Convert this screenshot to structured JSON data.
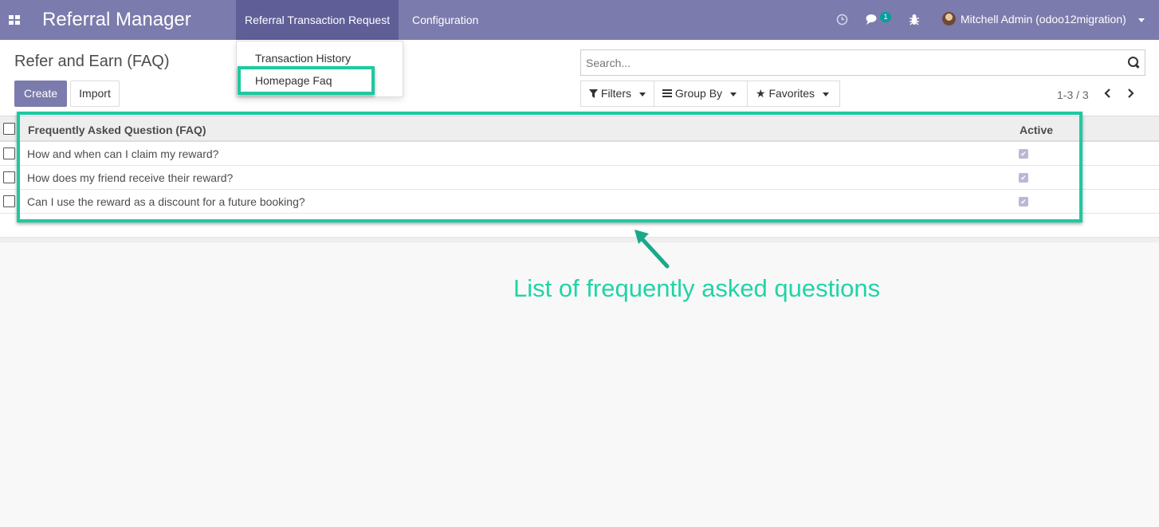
{
  "navbar": {
    "brand": "Referral Manager",
    "menus": [
      "Referral Transaction Request",
      "Configuration"
    ],
    "chat_badge": "1",
    "user": "Mitchell Admin (odoo12migration)"
  },
  "dropdown": {
    "items": [
      "Transaction History",
      "Homepage Faq"
    ]
  },
  "control_panel": {
    "title": "Refer and Earn (FAQ)",
    "create_label": "Create",
    "import_label": "Import",
    "search_placeholder": "Search...",
    "filters_label": "Filters",
    "groupby_label": "Group By",
    "favorites_label": "Favorites",
    "pager": "1-3 / 3"
  },
  "table": {
    "headers": [
      "Frequently Asked Question (FAQ)",
      "Active"
    ],
    "rows": [
      {
        "question": "How and when can I claim my reward?",
        "active": true
      },
      {
        "question": "How does my friend receive their reward?",
        "active": true
      },
      {
        "question": "Can I use the reward as a discount for a future booking?",
        "active": true
      }
    ]
  },
  "annotation": {
    "text": "List of frequently asked questions",
    "color": "#20d4a6"
  },
  "colors": {
    "navbar": "#7c7bad",
    "primary": "#7c7bad",
    "highlight": "#1dc9a0"
  }
}
